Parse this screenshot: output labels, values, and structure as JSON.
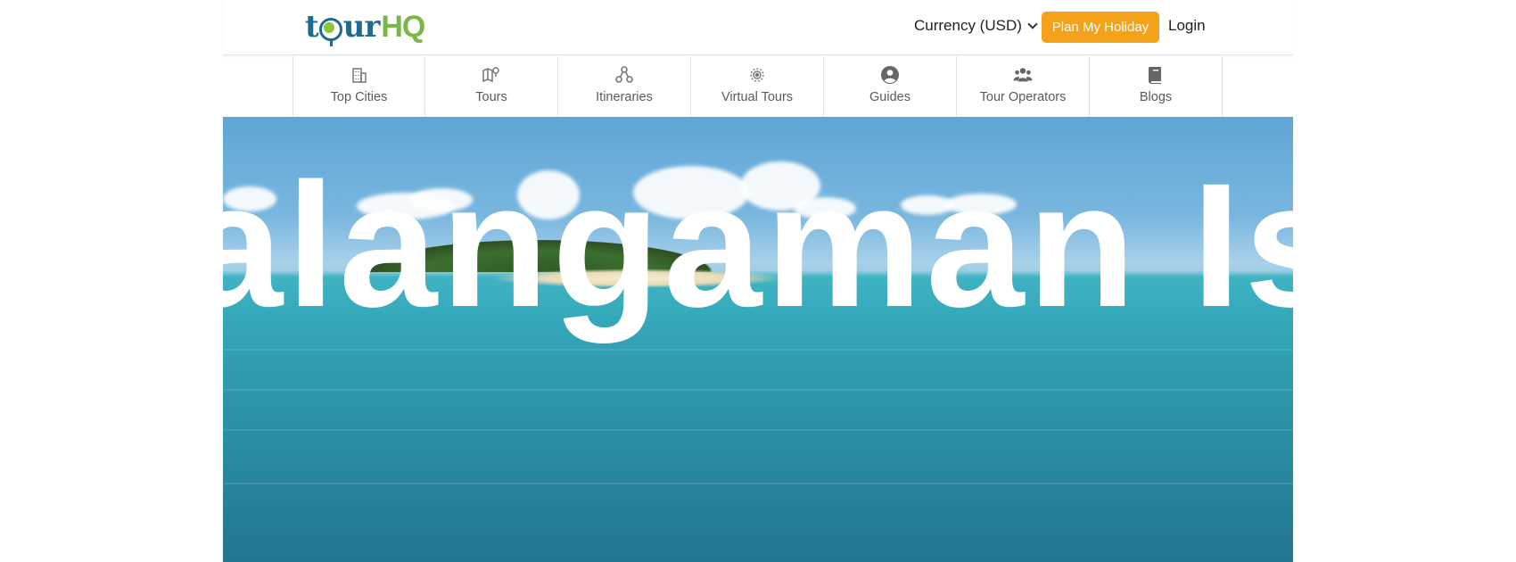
{
  "header": {
    "logo_text_a": "t",
    "logo_text_b": "ur",
    "logo_text_hq": "HQ",
    "currency_label": "Currency (USD)",
    "plan_button_label": "Plan My Holiday",
    "login_label": "Login"
  },
  "nav": {
    "items": [
      {
        "label": "Top Cities",
        "icon": "building-icon"
      },
      {
        "label": "Tours",
        "icon": "map-pin-icon"
      },
      {
        "label": "Itineraries",
        "icon": "nodes-icon"
      },
      {
        "label": "Virtual Tours",
        "icon": "virtual-tour-icon"
      },
      {
        "label": "Guides",
        "icon": "user-circle-icon"
      },
      {
        "label": "Tour Operators",
        "icon": "users-group-icon"
      },
      {
        "label": "Blogs",
        "icon": "book-icon"
      }
    ]
  },
  "hero": {
    "title": "Dalangaman Island"
  },
  "colors": {
    "brand_blue": "#1f6b8e",
    "brand_green": "#7ab648",
    "accent_orange": "#f5a21b"
  }
}
